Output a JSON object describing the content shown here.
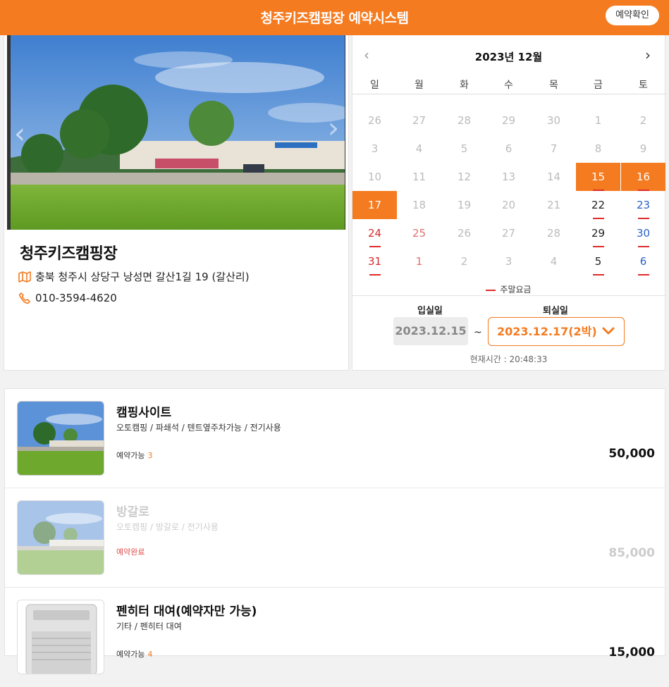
{
  "header": {
    "title": "청주키즈캠핑장 예약시스템",
    "confirm_button": "예약확인"
  },
  "site": {
    "name": "청주키즈캠핑장",
    "address": "충북 청주시 상당구 낭성면 갈산1길 19 (갈산리)",
    "phone": "010-3594-4620"
  },
  "calendar": {
    "title": "2023년 12월",
    "weekdays": [
      "일",
      "월",
      "화",
      "수",
      "목",
      "금",
      "토"
    ],
    "weeks": [
      [
        "26",
        "27",
        "28",
        "29",
        "30",
        "1",
        "2"
      ],
      [
        "3",
        "4",
        "5",
        "6",
        "7",
        "8",
        "9"
      ],
      [
        "10",
        "11",
        "12",
        "13",
        "14",
        "15",
        "16"
      ],
      [
        "17",
        "18",
        "19",
        "20",
        "21",
        "22",
        "23"
      ],
      [
        "24",
        "25",
        "26",
        "27",
        "28",
        "29",
        "30"
      ],
      [
        "31",
        "1",
        "2",
        "3",
        "4",
        "5",
        "6"
      ]
    ],
    "legend": "주말요금",
    "checkin_label": "입실일",
    "checkout_label": "퇴실일",
    "checkin_value": "2023.12.15",
    "checkout_value": "2023.12.17(2박)",
    "tilde": "~",
    "current_time": "현재시간 : 20:48:33",
    "colors": {
      "accent": "#f47b20",
      "weekend_line": "#e02b2b",
      "saturday": "#2a62c9",
      "sunday": "#d62b2b"
    }
  },
  "products": [
    {
      "title": "캠핑사이트",
      "desc": "오토캠핑 / 파쇄석 / 텐트옆주차가능 / 전기사용",
      "avail_label": "예약가능",
      "avail_count": "3",
      "price": "50,000"
    },
    {
      "title": "방갈로",
      "desc": "오토캠핑 / 방갈로 / 전기사용",
      "status": "예약완료",
      "price": "85,000"
    },
    {
      "title": "펜히터 대여(예약자만 가능)",
      "desc": "기타 / 펜히터 대여",
      "avail_label": "예약가능",
      "avail_count": "4",
      "price": "15,000"
    }
  ]
}
